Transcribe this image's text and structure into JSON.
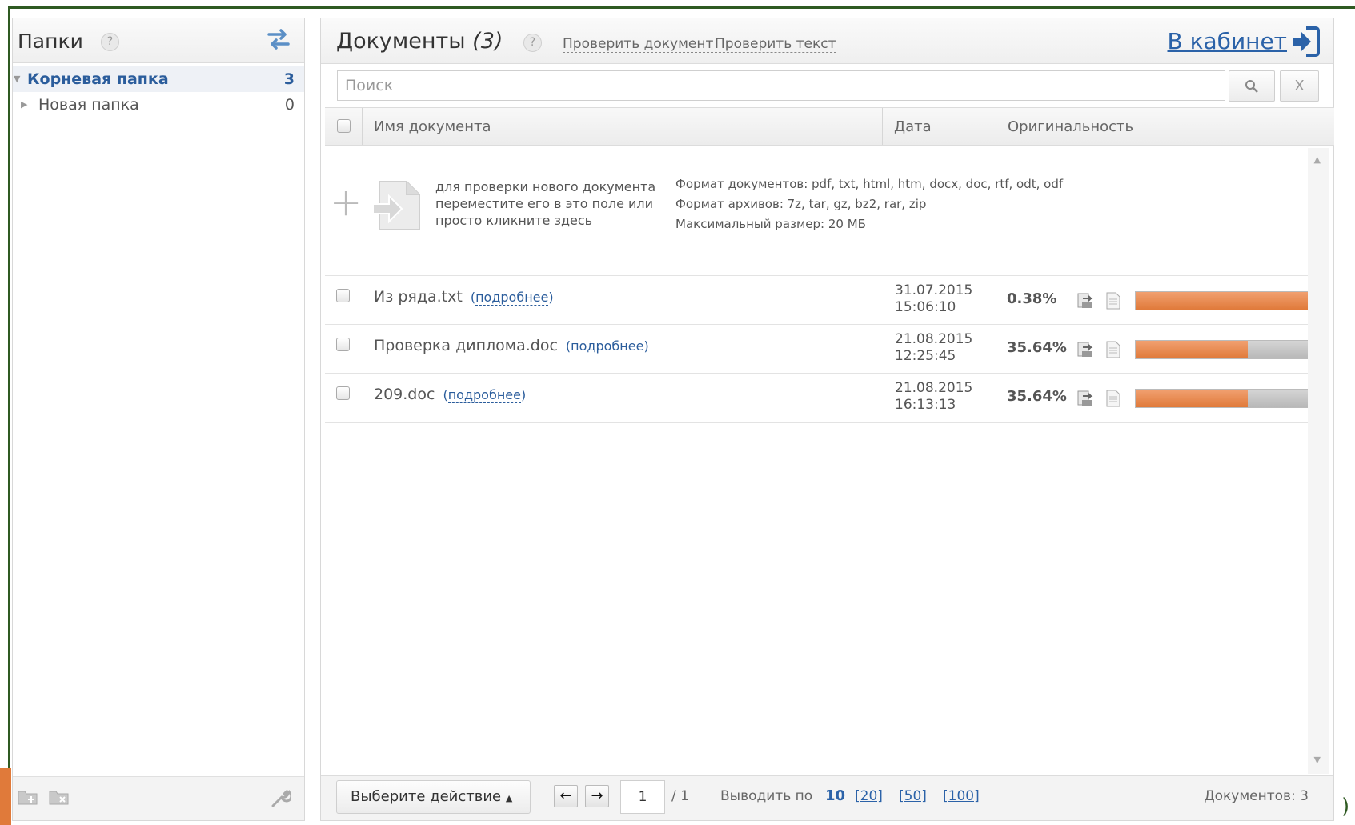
{
  "folders": {
    "title": "Папки",
    "help": "?",
    "items": [
      {
        "label": "Корневая папка",
        "count": "3"
      },
      {
        "label": "Новая папка",
        "count": "0"
      }
    ]
  },
  "documents": {
    "title": "Документы",
    "count": "(3)",
    "help": "?",
    "check_document": "Проверить документ",
    "check_text": "Проверить текст",
    "cabinet": "В кабинет"
  },
  "search": {
    "placeholder": "Поиск",
    "clear": "X"
  },
  "table": {
    "col_name": "Имя документа",
    "col_date": "Дата",
    "col_originality": "Оригинальность"
  },
  "drop_zone": {
    "plus": "+",
    "text_lines": [
      "для проверки нового документа",
      "переместите его в это поле или",
      "просто кликните здесь"
    ],
    "doc_formats": "Формат документов: pdf, txt, html, htm, docx, doc, rtf, odt, odf",
    "archive_formats": "Формат архивов: 7z, tar, gz, bz2, rar, zip",
    "max_size": "Максимальный размер: 20 МБ"
  },
  "rows": [
    {
      "name": "Из ряда.txt",
      "more": "подробнее",
      "date": "31.07.2015",
      "time": "15:06:10",
      "originality": "0.38%",
      "bar_fraction": 0.99
    },
    {
      "name": "Проверка диплома.doc",
      "more": "подробнее",
      "date": "21.08.2015",
      "time": "12:25:45",
      "originality": "35.64%",
      "bar_fraction": 0.64
    },
    {
      "name": "209.doc",
      "more": "подробнее",
      "date": "21.08.2015",
      "time": "16:13:13",
      "originality": "35.64%",
      "bar_fraction": 0.64
    }
  ],
  "footer": {
    "action": "Выберите действие",
    "prev": "←",
    "next": "→",
    "page": "1",
    "of_pages": "/ 1",
    "per_page_label": "Выводить по",
    "per_page_current": "10",
    "per_page_options": [
      "[20]",
      "[50]",
      "[100]"
    ],
    "total": "Документов: 3"
  },
  "colors": {
    "accent": "#2b62a8",
    "progress": "#e07a3a",
    "frame": "#2f5a22"
  }
}
